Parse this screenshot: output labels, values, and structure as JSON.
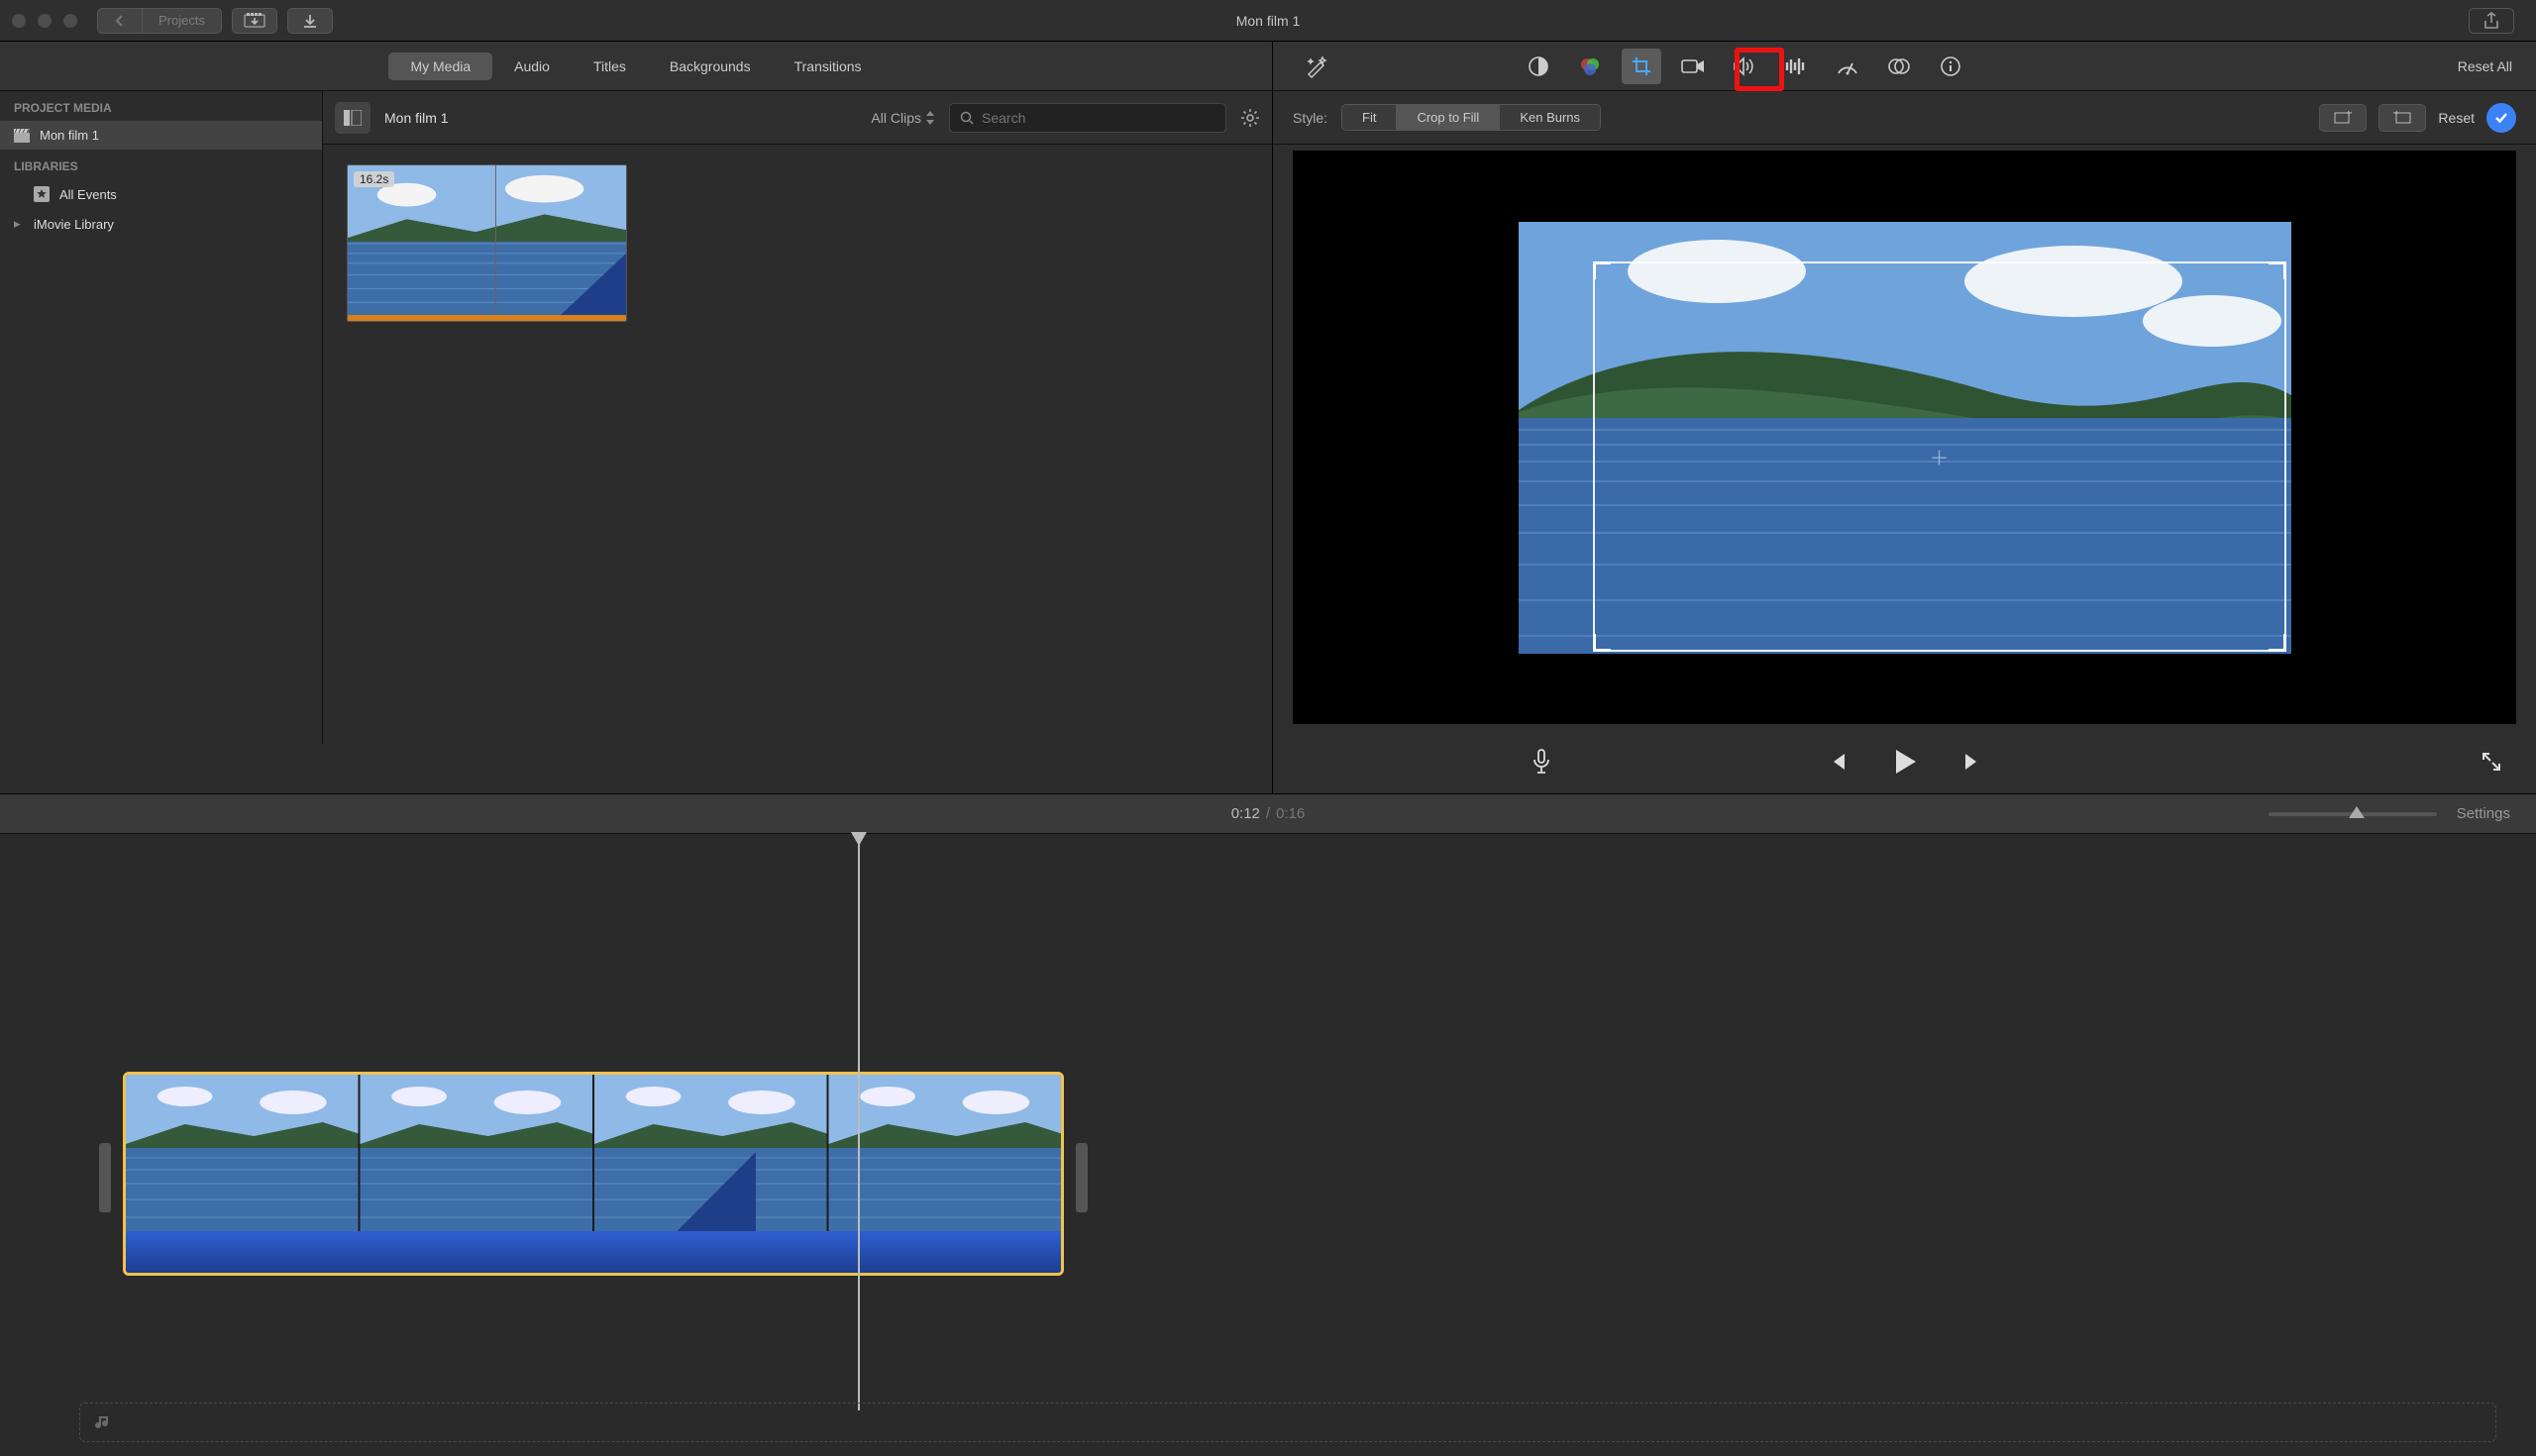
{
  "window": {
    "title": "Mon film 1"
  },
  "titlebar": {
    "projects_label": "Projects"
  },
  "browser": {
    "tabs": [
      "My Media",
      "Audio",
      "Titles",
      "Backgrounds",
      "Transitions"
    ],
    "active_tab": 0,
    "breadcrumb": "Mon film 1",
    "filter_label": "All Clips",
    "search_placeholder": "Search"
  },
  "sidebar": {
    "project_media_heading": "PROJECT MEDIA",
    "project_item": "Mon film 1",
    "libraries_heading": "LIBRARIES",
    "all_events": "All Events",
    "imovie_library": "iMovie Library"
  },
  "clip": {
    "duration_badge": "16.2s"
  },
  "adjust": {
    "reset_all": "Reset All",
    "style_label": "Style:",
    "fit": "Fit",
    "crop_to_fill": "Crop to Fill",
    "ken_burns": "Ken Burns",
    "reset": "Reset"
  },
  "playback": {
    "current": "0:12",
    "total": "0:16",
    "settings": "Settings"
  }
}
